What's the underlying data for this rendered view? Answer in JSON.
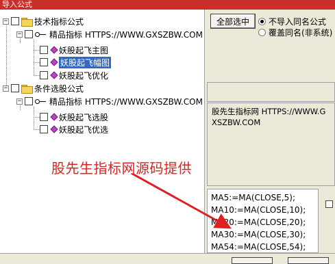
{
  "window": {
    "title": "导入公式"
  },
  "tree": {
    "groups": [
      {
        "label": "技术指标公式",
        "source": "精品指标 HTTPS://WWW.GXSZBW.COM",
        "items": [
          "妖股起飞主图",
          "妖股起飞幅图",
          "妖股起飞优化"
        ],
        "selected_index": 1
      },
      {
        "label": "条件选股公式",
        "source": "精品指标 HTTPS://WWW.GXSZBW.COM",
        "items": [
          "妖股起飞选股",
          "妖股起飞优选"
        ]
      }
    ]
  },
  "options": {
    "select_all_label": "全部选中",
    "radio_no_import_label": "不导入同名公式",
    "radio_overwrite_label": "覆盖同名(非系统)",
    "selected_radio": "no_import"
  },
  "description": "股先生指标网 HTTPS://WWW.GXSZBW.COM",
  "code_lines": [
    "MA5:=MA(CLOSE,5);",
    "MA10:=MA(CLOSE,10);",
    "MA20:=MA(CLOSE,20);",
    "MA30:=MA(CLOSE,30);",
    "MA54:=MA(CLOSE,54);"
  ],
  "overlay": {
    "text": "股先生指标网源码提供",
    "color": "#e02020"
  },
  "colors": {
    "title_bar": "#c9302c",
    "selection": "#316ac5",
    "window_bg": "#ece9d8"
  }
}
